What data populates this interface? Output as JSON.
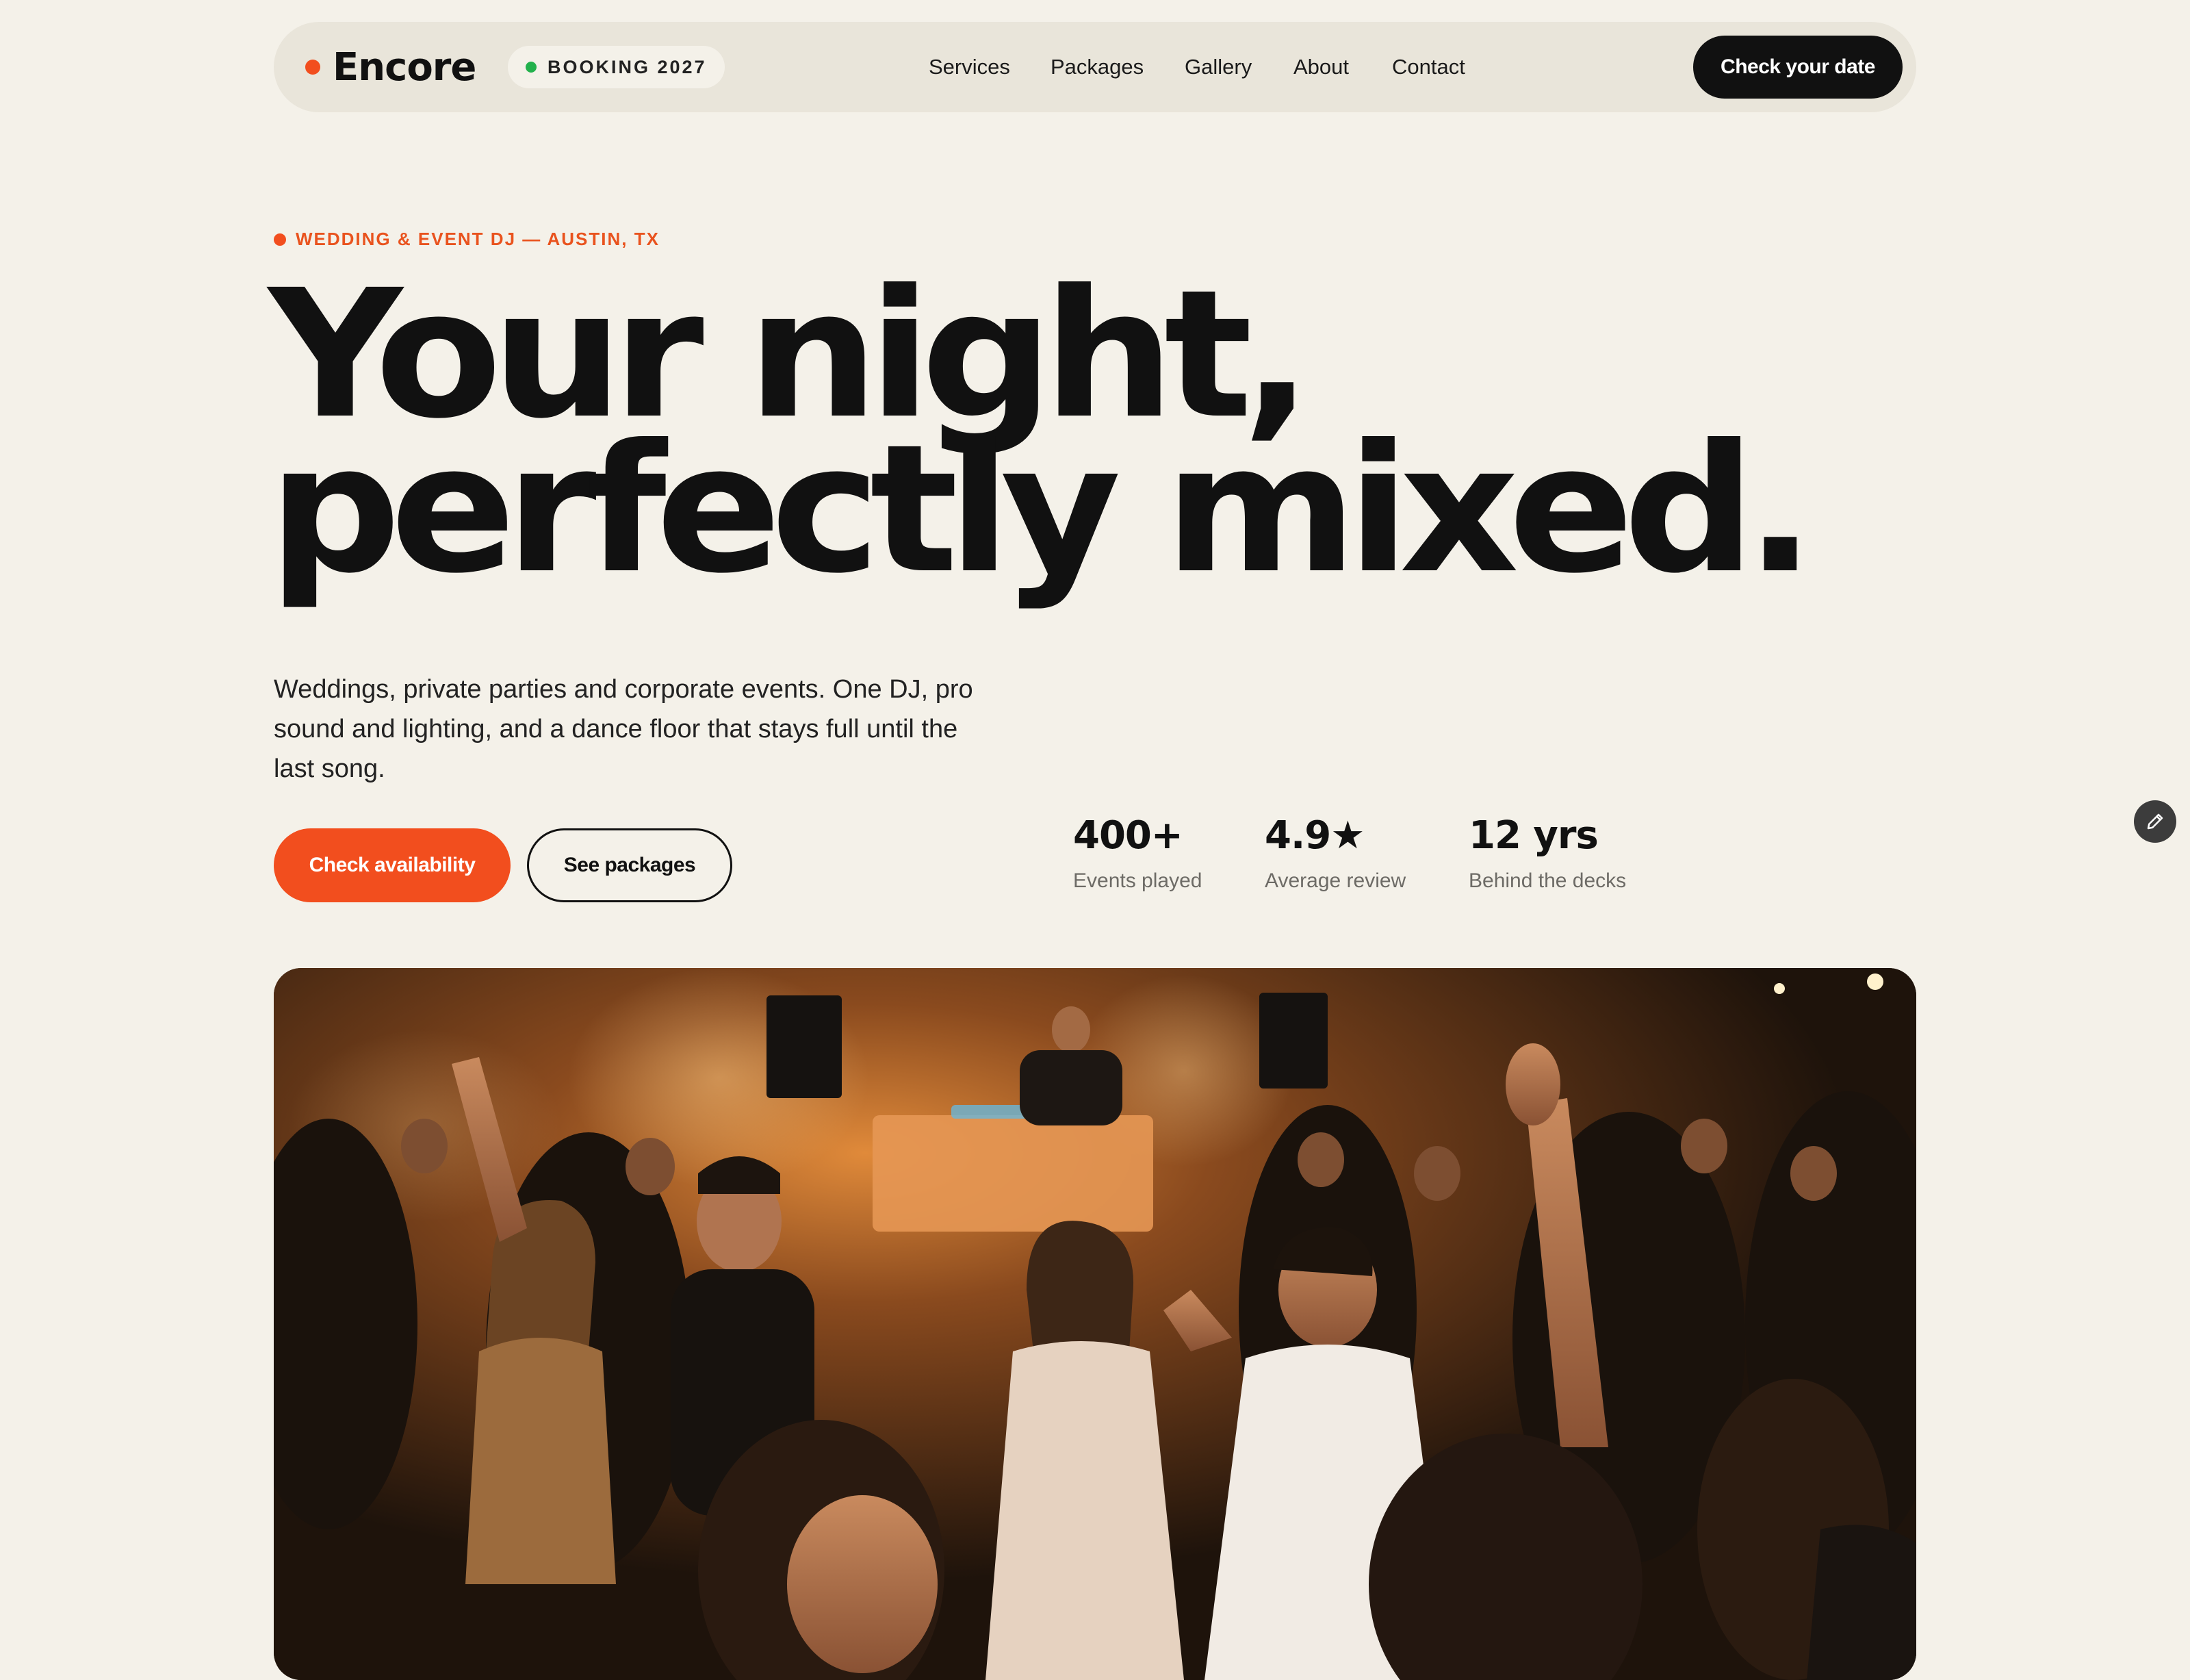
{
  "nav": {
    "brand": "Encore",
    "badge": "BOOKING 2027",
    "links": [
      "Services",
      "Packages",
      "Gallery",
      "About",
      "Contact"
    ],
    "cta": "Check your date"
  },
  "hero": {
    "eyebrow": "WEDDING & EVENT DJ — AUSTIN, TX",
    "headline_line1": "Your night,",
    "headline_line2": "perfectly mixed.",
    "description": "Weddings, private parties and corporate events. One DJ, pro sound and lighting, and a dance floor that stays full until the last song.",
    "primary_cta": "Check availability",
    "secondary_cta": "See packages"
  },
  "stats": [
    {
      "value": "400+",
      "label": "Events played"
    },
    {
      "value": "4.9★",
      "label": "Average review"
    },
    {
      "value": "12 yrs",
      "label": "Behind the decks"
    }
  ],
  "icons": {
    "edit": "pencil-icon"
  },
  "colors": {
    "accent": "#f24e1e",
    "background": "#f4f1e9",
    "nav_bg": "#e9e5da",
    "text": "#111111",
    "status_green": "#22b14c"
  }
}
